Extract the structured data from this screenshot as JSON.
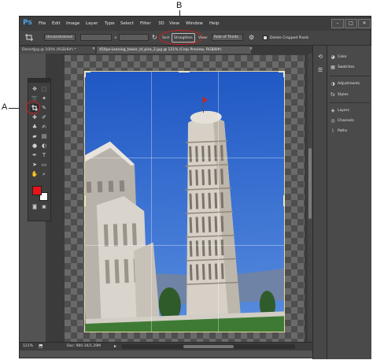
{
  "callouts": {
    "a": "A",
    "b": "B"
  },
  "app": {
    "logo": "Ps",
    "menu": [
      "File",
      "Edit",
      "Image",
      "Layer",
      "Type",
      "Select",
      "Filter",
      "3D",
      "View",
      "Window",
      "Help"
    ],
    "window_buttons": [
      "–",
      "□",
      "✕"
    ]
  },
  "options_bar": {
    "ratio_value": "Unconstrained",
    "times_symbol": "×",
    "sort_label": "Sort",
    "straighten_label": "Straighten",
    "view_label": "View:",
    "view_value": "Rule of Thirds",
    "delete_label": "Delete Cropped Pixels"
  },
  "tabs": [
    "DesertJpg @ 100% (RGB/8#) *",
    "450px-Leaning_tower_of_pisa_2.jpg @ 121% (Crop Preview, RGB/8#)"
  ],
  "tab_close": "×",
  "panels": {
    "items": [
      {
        "icon": "color-icon",
        "label": "Color"
      },
      {
        "icon": "swatches-icon",
        "label": "Swatches"
      },
      {
        "icon": "adjustments-icon",
        "label": "Adjustments"
      },
      {
        "icon": "styles-icon",
        "label": "Styles"
      },
      {
        "icon": "layers-icon",
        "label": "Layers"
      },
      {
        "icon": "channels-icon",
        "label": "Channels"
      },
      {
        "icon": "paths-icon",
        "label": "Paths"
      }
    ]
  },
  "status": {
    "zoom": "121%",
    "doc": "Doc: 900.1K/1.29M"
  },
  "colors": {
    "foreground": "#e8141a",
    "background": "#ffffff",
    "sky": "#2f6bd0",
    "highlight_circle": "#d11d1d"
  }
}
